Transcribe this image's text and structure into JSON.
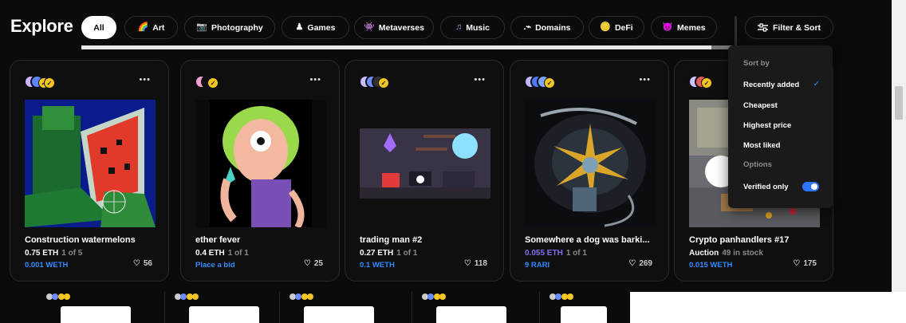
{
  "header": {
    "title": "Explore",
    "filter_label": "Filter & Sort",
    "categories": [
      {
        "label": "All",
        "icon": "",
        "active": true
      },
      {
        "label": "Art",
        "icon": "🌈",
        "active": false
      },
      {
        "label": "Photography",
        "icon": "📷",
        "active": false
      },
      {
        "label": "Games",
        "icon": "♟",
        "active": false
      },
      {
        "label": "Metaverses",
        "icon": "👾",
        "active": false
      },
      {
        "label": "Music",
        "icon": "♫",
        "active": false
      },
      {
        "label": "Domains",
        "icon": ".⌁",
        "active": false
      },
      {
        "label": "DeFi",
        "icon": "🪙",
        "active": false
      },
      {
        "label": "Memes",
        "icon": "😈",
        "active": false
      }
    ]
  },
  "dropdown": {
    "sort_by_label": "Sort by",
    "options_label": "Options",
    "items": [
      "Recently added",
      "Cheapest",
      "Highest price",
      "Most liked"
    ],
    "selected": "Recently added",
    "verified_label": "Verified only",
    "verified_on": true
  },
  "cards": [
    {
      "title": "Construction watermelons",
      "price": "0.75 ETH",
      "stock": "1 of 5",
      "bid": "0.001 WETH",
      "likes": "56"
    },
    {
      "title": "ether fever",
      "price": "0.4 ETH",
      "stock": "1 of 1",
      "bid": "Place a bid",
      "likes": "25"
    },
    {
      "title": "trading man #2",
      "price": "0.27 ETH",
      "stock": "1 of 1",
      "bid": "0.1 WETH",
      "likes": "118"
    },
    {
      "title": "Somewhere a dog was barki...",
      "price": "0.055 ETH",
      "stock": "1 of 1",
      "bid": "9 RARI",
      "likes": "269"
    },
    {
      "title": "Crypto panhandlers #17",
      "price": "Auction",
      "stock": "49 in stock",
      "bid": "0.015 WETH",
      "likes": "175"
    }
  ],
  "colors": {
    "accent": "#2f8cff",
    "background": "#0b0b0b",
    "card_border": "#2a2a2a"
  }
}
